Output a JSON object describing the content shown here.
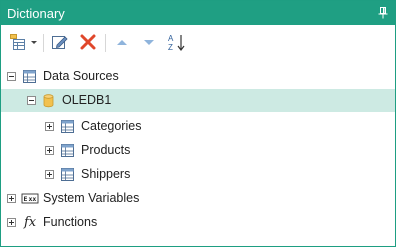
{
  "panel": {
    "title": "Dictionary"
  },
  "icons": {
    "pin": "pin-icon",
    "new_item": "new-item-dropdown-icon",
    "edit": "edit-icon",
    "delete": "delete-icon",
    "move_up": "move-up-icon",
    "move_down": "move-down-icon",
    "sort": "sort-az-icon"
  },
  "tree": {
    "data_sources": {
      "label": "Data Sources",
      "expanded": true
    },
    "oledb": {
      "label": "OLEDB1",
      "expanded": true,
      "selected": true
    },
    "tables": [
      {
        "label": "Categories"
      },
      {
        "label": "Products"
      },
      {
        "label": "Shippers"
      }
    ],
    "system_variables": {
      "label": "System Variables"
    },
    "functions": {
      "label": "Functions",
      "icon_text": "fx"
    }
  },
  "colors": {
    "accent": "#1f9f83",
    "selection": "#cdeae3",
    "delete_red": "#e0472b",
    "arrow_blue": "#8fb4dc"
  }
}
